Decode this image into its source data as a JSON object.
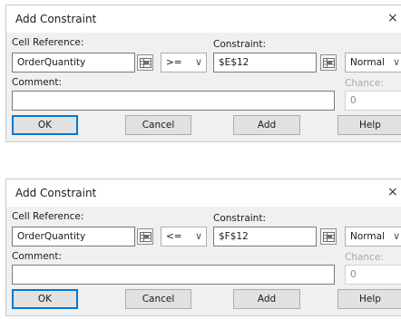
{
  "dialogs": [
    {
      "title": "Add Constraint",
      "cell_reference_label": "Cell Reference:",
      "cell_reference_value": "OrderQuantity",
      "operator": ">=",
      "constraint_label": "Constraint:",
      "constraint_value": "$E$12",
      "type_value": "Normal",
      "comment_label": "Comment:",
      "comment_value": "",
      "chance_label": "Chance:",
      "chance_value": "0",
      "buttons": {
        "ok": "OK",
        "cancel": "Cancel",
        "add": "Add",
        "help": "Help"
      }
    },
    {
      "title": "Add Constraint",
      "cell_reference_label": "Cell Reference:",
      "cell_reference_value": "OrderQuantity",
      "operator": "<=",
      "constraint_label": "Constraint:",
      "constraint_value": "$F$12",
      "type_value": "Normal",
      "comment_label": "Comment:",
      "comment_value": "",
      "chance_label": "Chance:",
      "chance_value": "0",
      "buttons": {
        "ok": "OK",
        "cancel": "Cancel",
        "add": "Add",
        "help": "Help"
      }
    }
  ],
  "glyphs": {
    "close": "×",
    "chevron": "∨"
  },
  "icons": {
    "close": "close-icon",
    "range_selector": "range-selector-icon",
    "dropdown": "chevron-down-icon"
  },
  "colors": {
    "title_bar": "#ffffff",
    "dialog_body": "#f0f0f0",
    "default_button_border": "#0078d7",
    "button_face": "#e1e1e1",
    "disabled_text": "#a9a9a9"
  }
}
